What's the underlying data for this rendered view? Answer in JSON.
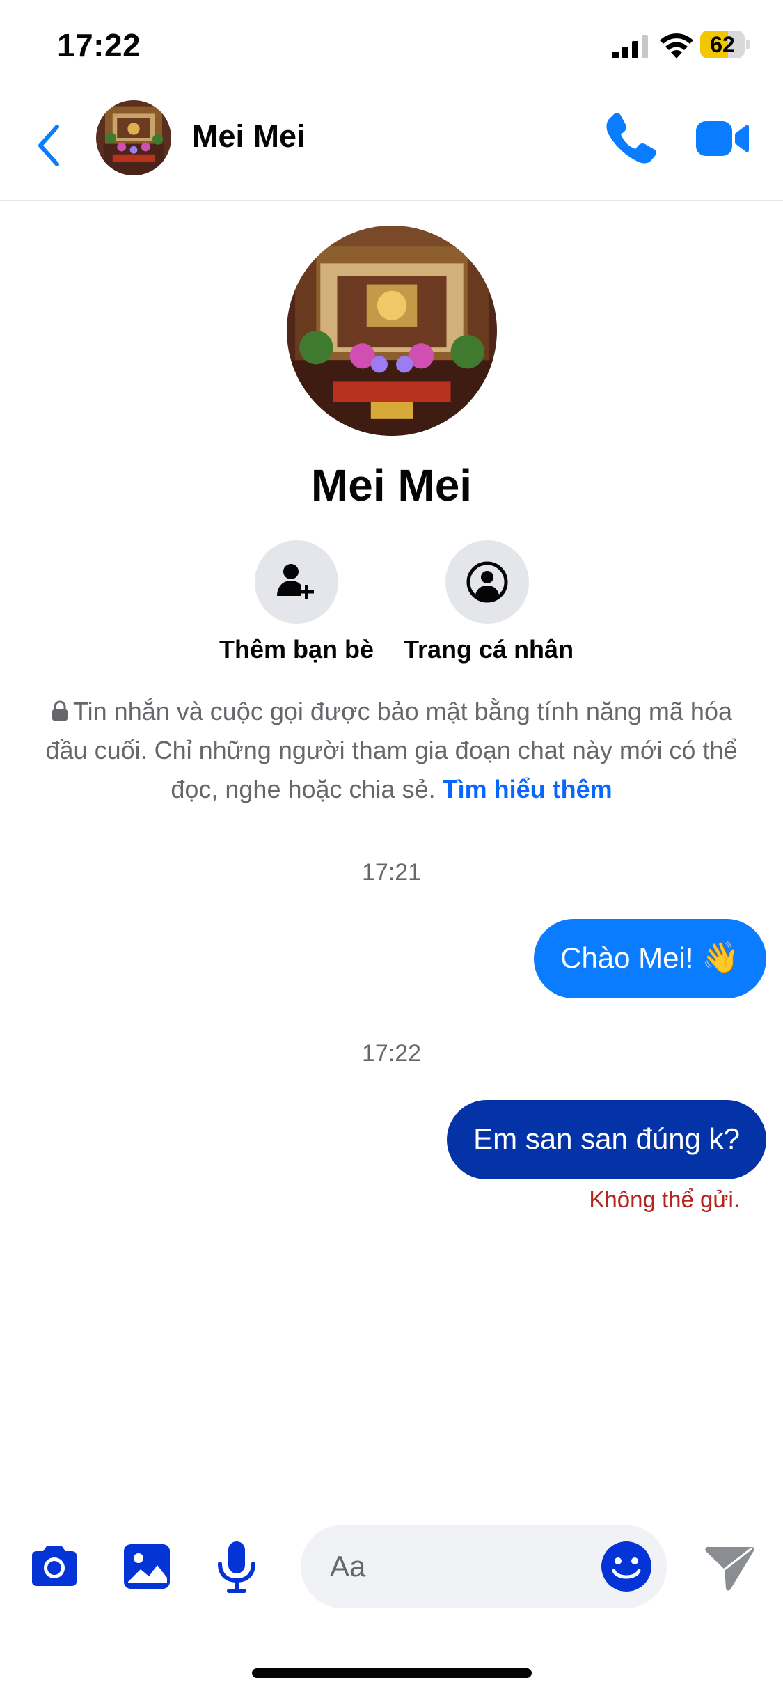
{
  "status_bar": {
    "time": "17:22",
    "battery": "62",
    "battery_level": 0.62
  },
  "header": {
    "name": "Mei Mei"
  },
  "profile": {
    "name": "Mei Mei",
    "actions": [
      {
        "label": "Thêm bạn bè",
        "icon": "add-friend-icon"
      },
      {
        "label": "Trang cá nhân",
        "icon": "profile-icon"
      }
    ]
  },
  "encryption_notice": {
    "text": "Tin nhắn và cuộc gọi được bảo mật bằng tính năng mã hóa đầu cuối. Chỉ những người tham gia đoạn chat này mới có thể đọc, nghe hoặc chia sẻ.",
    "link": "Tìm hiểu thêm"
  },
  "messages": [
    {
      "timestamp": "17:21",
      "text": "Chào Mei!",
      "emoji": "👋"
    },
    {
      "timestamp": "17:22",
      "text": "Em san san đúng k?",
      "status": "Không thể gửi."
    }
  ],
  "composer": {
    "placeholder": "Aa"
  },
  "colors": {
    "accent": "#0a7cff",
    "dark_bubble": "#0433a8",
    "composer_icon": "#0433d6",
    "error": "#b3261e"
  }
}
